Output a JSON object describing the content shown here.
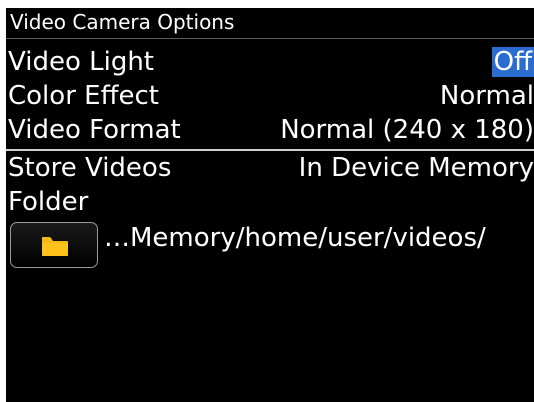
{
  "window": {
    "title": "Video Camera Options"
  },
  "options": {
    "video_light": {
      "label": "Video Light",
      "value": "Off"
    },
    "color_effect": {
      "label": "Color Effect",
      "value": "Normal"
    },
    "video_format": {
      "label": "Video Format",
      "value": "Normal (240 x 180)"
    },
    "store_videos": {
      "label": "Store Videos",
      "value": "In Device Memory"
    }
  },
  "folder": {
    "label": "Folder",
    "path": "…Memory/home/user/videos/",
    "icon": "folder-icon"
  },
  "colors": {
    "background": "#000000",
    "text": "#ffffff",
    "selection": "#2a6ccf",
    "folder_icon": "#f6b817"
  }
}
